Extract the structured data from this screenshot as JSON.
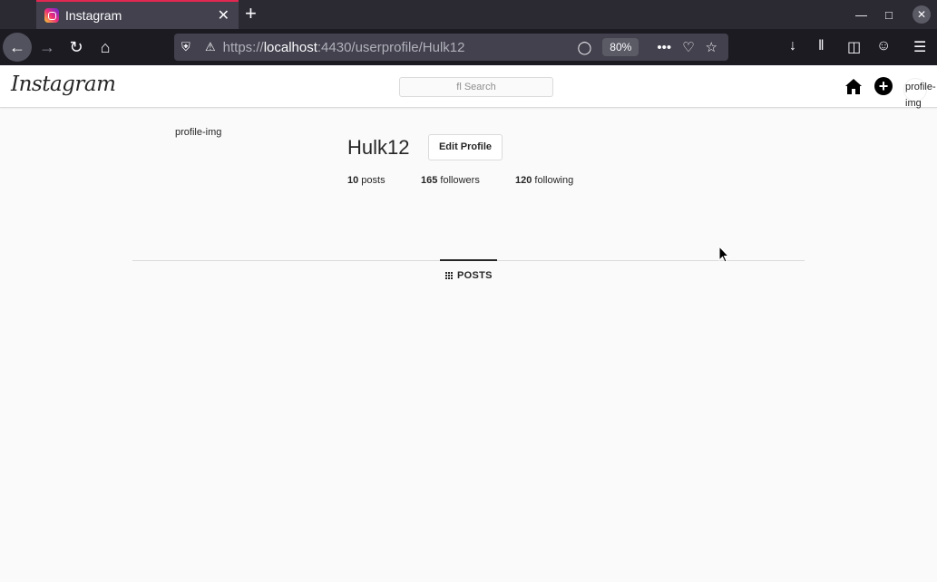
{
  "browser": {
    "tab_title": "Instagram",
    "tab_close": "✕",
    "new_tab": "+",
    "url_host": "localhost",
    "url_prefix": "https://",
    "url_rest": ":4430/userprofile/Hulk12",
    "zoom": "80%"
  },
  "header": {
    "logo": "Instagram",
    "search_placeholder": "fl Search",
    "avatar_alt": "profile-img"
  },
  "profile": {
    "img_alt": "profile-img",
    "username": "Hulk12",
    "edit_button": "Edit Profile",
    "stats": {
      "posts_count": "10",
      "posts_label": " posts",
      "followers_count": "165",
      "followers_label": " followers",
      "following_count": "120",
      "following_label": " following"
    }
  },
  "tabs": {
    "posts_label": "POSTS"
  }
}
